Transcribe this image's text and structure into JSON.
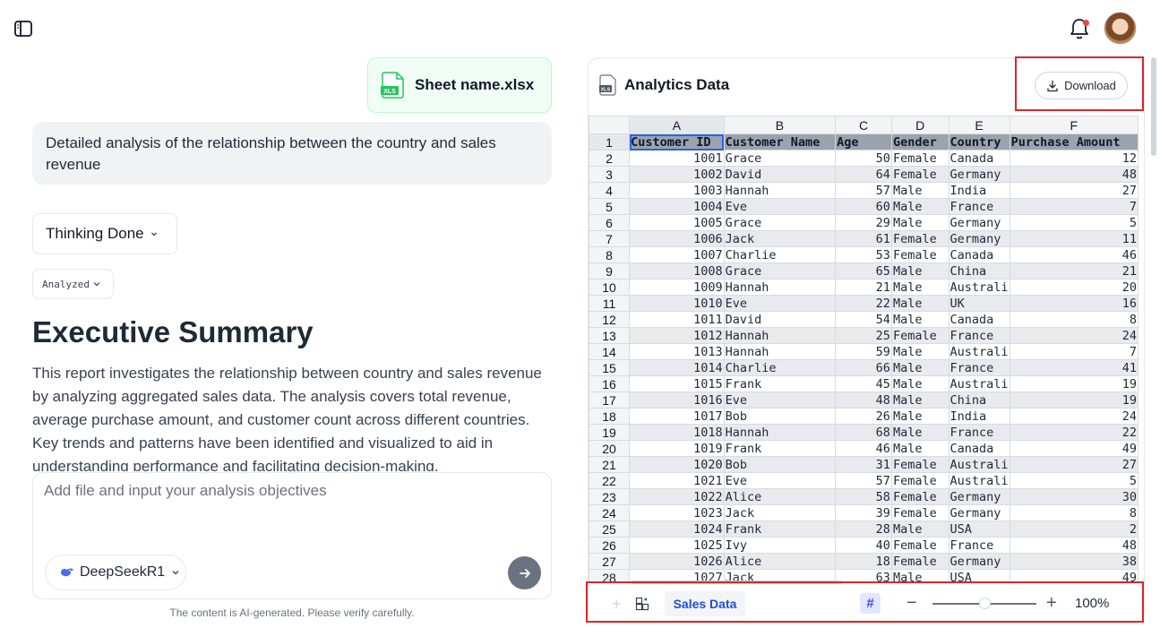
{
  "header": {
    "sidebar_toggle_icon": "sidebar-toggle-icon",
    "notification_icon": "bell-icon",
    "avatar_icon": "user-avatar"
  },
  "chat": {
    "file_chip": {
      "name": "Sheet name.xlsx",
      "icon": "xls-file-icon"
    },
    "user_message": "Detailed analysis of the relationship between the country and sales revenue",
    "thinking_label": "Thinking Done",
    "analyzed_label": "Analyzed",
    "summary_title": "Executive Summary",
    "summary_body": "This report investigates the relationship between country and sales revenue by analyzing aggregated sales data. The analysis covers total revenue, average purchase amount, and customer count across different countries. Key trends and patterns have been identified and visualized to aid in understanding performance and facilitating decision-making.",
    "input_placeholder": "Add file and input your analysis objectives",
    "model_label": "DeepSeekR1",
    "disclaimer": "The content is AI-generated. Please verify carefully."
  },
  "panel": {
    "title": "Analytics Data",
    "download_label": "Download",
    "columns": [
      "A",
      "B",
      "C",
      "D",
      "E",
      "F"
    ],
    "header_cells": [
      "Customer ID",
      "Customer Name",
      "Age",
      "Gender",
      "Country",
      "Purchase Amount"
    ],
    "rows": [
      [
        "1001",
        "Grace",
        "50",
        "Female",
        "Canada",
        "12"
      ],
      [
        "1002",
        "David",
        "64",
        "Female",
        "Germany",
        "48"
      ],
      [
        "1003",
        "Hannah",
        "57",
        "Male",
        "India",
        "27"
      ],
      [
        "1004",
        "Eve",
        "60",
        "Male",
        "France",
        "7"
      ],
      [
        "1005",
        "Grace",
        "29",
        "Male",
        "Germany",
        "5"
      ],
      [
        "1006",
        "Jack",
        "61",
        "Female",
        "Germany",
        "11"
      ],
      [
        "1007",
        "Charlie",
        "53",
        "Female",
        "Canada",
        "46"
      ],
      [
        "1008",
        "Grace",
        "65",
        "Male",
        "China",
        "21"
      ],
      [
        "1009",
        "Hannah",
        "21",
        "Male",
        "Australi",
        "20"
      ],
      [
        "1010",
        "Eve",
        "22",
        "Male",
        "UK",
        "16"
      ],
      [
        "1011",
        "David",
        "54",
        "Male",
        "Canada",
        "8"
      ],
      [
        "1012",
        "Hannah",
        "25",
        "Female",
        "France",
        "24"
      ],
      [
        "1013",
        "Hannah",
        "59",
        "Male",
        "Australi",
        "7"
      ],
      [
        "1014",
        "Charlie",
        "66",
        "Male",
        "France",
        "41"
      ],
      [
        "1015",
        "Frank",
        "45",
        "Male",
        "Australi",
        "19"
      ],
      [
        "1016",
        "Eve",
        "48",
        "Male",
        "China",
        "19"
      ],
      [
        "1017",
        "Bob",
        "26",
        "Male",
        "India",
        "24"
      ],
      [
        "1018",
        "Hannah",
        "68",
        "Male",
        "France",
        "22"
      ],
      [
        "1019",
        "Frank",
        "46",
        "Male",
        "Canada",
        "49"
      ],
      [
        "1020",
        "Bob",
        "31",
        "Female",
        "Australi",
        "27"
      ],
      [
        "1021",
        "Eve",
        "57",
        "Female",
        "Australi",
        "5"
      ],
      [
        "1022",
        "Alice",
        "58",
        "Female",
        "Germany",
        "30"
      ],
      [
        "1023",
        "Jack",
        "39",
        "Female",
        "Germany",
        "8"
      ],
      [
        "1024",
        "Frank",
        "28",
        "Male",
        "USA",
        "2"
      ],
      [
        "1025",
        "Ivy",
        "40",
        "Female",
        "France",
        "48"
      ],
      [
        "1026",
        "Alice",
        "18",
        "Female",
        "Germany",
        "38"
      ],
      [
        "1027",
        "Jack",
        "63",
        "Male",
        "USA",
        "49"
      ]
    ],
    "sheet_tab": "Sales Data",
    "gridlines_icon": "#",
    "zoom_level": "100%",
    "zoom_fraction": 0.5
  }
}
